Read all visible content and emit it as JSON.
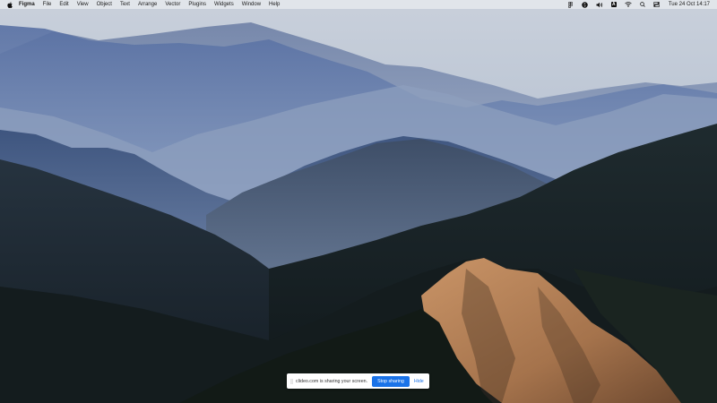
{
  "menubar": {
    "apple_icon": "apple-logo-icon",
    "app_name": "Figma",
    "items": [
      "File",
      "Edit",
      "View",
      "Object",
      "Text",
      "Arrange",
      "Vector",
      "Plugins",
      "Widgets",
      "Window",
      "Help"
    ],
    "status_icons": [
      "figma-icon",
      "shazam-icon",
      "volume-icon",
      "input-source-icon",
      "wifi-icon",
      "search-icon",
      "control-center-icon"
    ],
    "input_source_label": "A",
    "clock": "Tue 24 Oct  14:17"
  },
  "share_bar": {
    "message": "clideo.com is sharing your screen.",
    "stop_label": "Stop sharing",
    "hide_label": "Hide",
    "accent_color": "#1a73e8"
  },
  "wallpaper": {
    "description_icon": "mountain-landscape-wallpaper",
    "colors": {
      "sky": "#b9c3d3",
      "haze": "#8a9bb7",
      "ridge_far": "#3f5d90",
      "ridge_mid": "#2c3f5e",
      "ridge_dark": "#1b2733",
      "sunlit_slope": "#b7835a"
    }
  }
}
